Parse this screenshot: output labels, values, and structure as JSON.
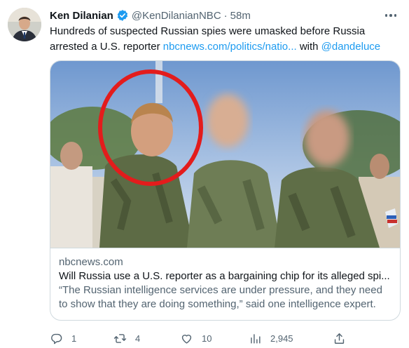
{
  "author": {
    "name": "Ken Dilanian",
    "handle": "@KenDilanianNBC",
    "separator": "·",
    "time": "58m",
    "verified": true
  },
  "tweet": {
    "text_before": "Hundreds of suspected Russian spies were umasked before Russia arrested a U.S. reporter ",
    "link_text": "nbcnews.com/politics/natio...",
    "text_middle": " with ",
    "mention": "@dandeluce"
  },
  "card": {
    "domain": "nbcnews.com",
    "title": "Will Russia use a U.S. reporter as a bargaining chip for its alleged spi...",
    "description": "“The Russian intelligence services are under pressure, and they need to show that they are doing something,” said one intelligence expert."
  },
  "actions": {
    "replies": "1",
    "retweets": "4",
    "likes": "10",
    "views": "2,945"
  },
  "icons": {
    "verified": "verified-badge-icon",
    "more": "more-options-icon",
    "reply": "reply-icon",
    "retweet": "retweet-icon",
    "like": "heart-icon",
    "views": "views-chart-icon",
    "share": "share-icon"
  },
  "colors": {
    "link": "#1d9bf0",
    "secondary_text": "#536471",
    "border": "#cfd9de",
    "highlight_circle": "#e31c1c"
  }
}
